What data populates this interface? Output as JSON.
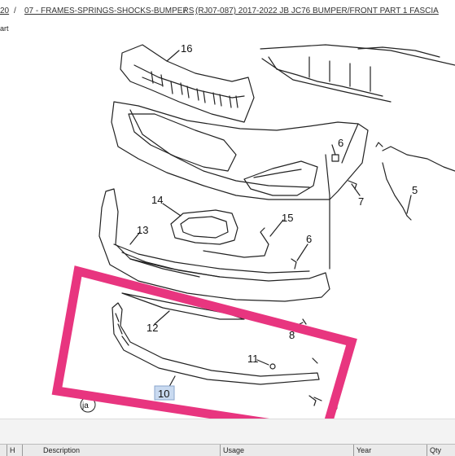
{
  "breadcrumb": {
    "item1": "20",
    "sep1": "/",
    "item2": "07 - FRAMES-SPRINGS-SHOCKS-BUMPERS",
    "sep2": "/",
    "item3": "(RJ07-087)  2017-2022  JB JC76  BUMPER/FRONT PART 1 FASCIA"
  },
  "subtitle": "art",
  "diagram": {
    "callouts": [
      "16",
      "6",
      "7",
      "5",
      "14",
      "15",
      "13",
      "6",
      "12",
      "8",
      "11",
      "9",
      "10"
    ],
    "highlight_color": "#e8357f",
    "selected_label": "10",
    "symbol": "ja"
  },
  "table": {
    "columns": [
      "H",
      "Description",
      "Usage",
      "Year",
      "Qty"
    ]
  }
}
